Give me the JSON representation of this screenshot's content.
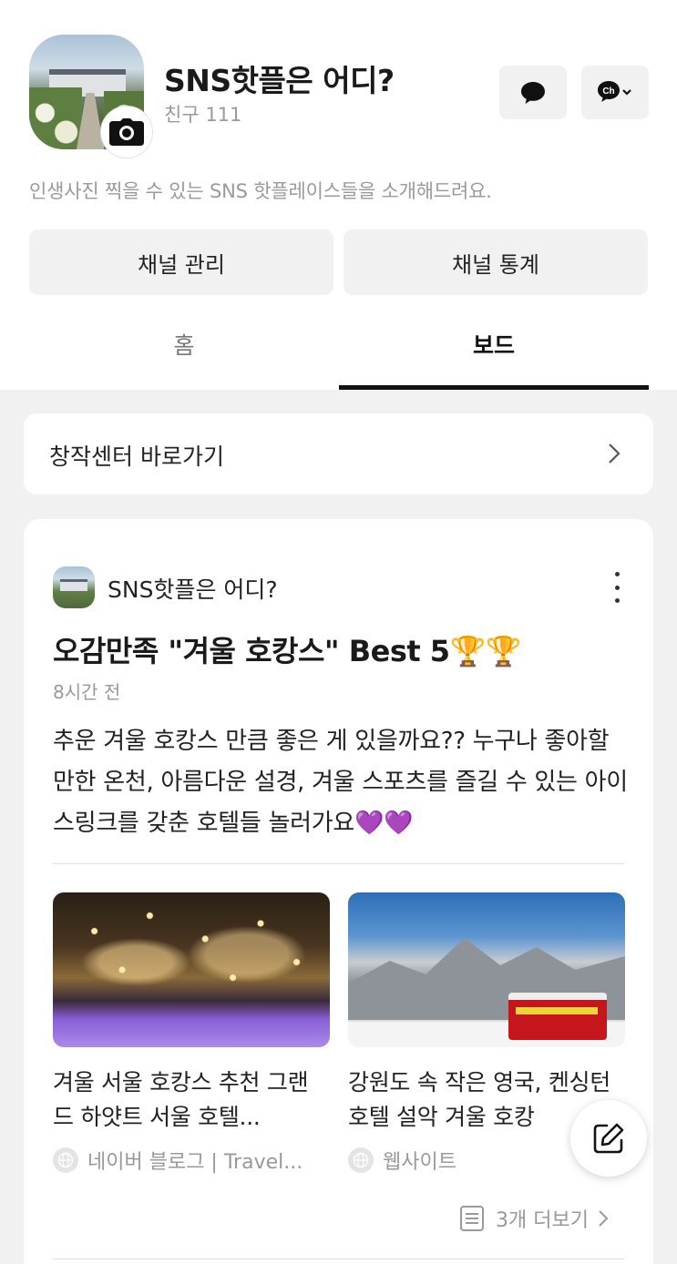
{
  "profile": {
    "name": "SNS핫플은 어디?",
    "friends": "친구 111",
    "description": "인생사진 찍을 수 있는 SNS 핫플레이스들을 소개해드려요."
  },
  "actions": {
    "manage_label": "채널 관리",
    "stats_label": "채널 통계",
    "ch_label": "Ch"
  },
  "tabs": [
    {
      "label": "홈",
      "active": false
    },
    {
      "label": "보드",
      "active": true
    }
  ],
  "creator_center": {
    "label": "창작센터 바로가기"
  },
  "post": {
    "author": "SNS핫플은 어디?",
    "title": "오감만족 \"겨울 호캉스\" Best 5🏆🏆",
    "time": "8시간 전",
    "body": "추운 겨울 호캉스 만큼 좋은 게 있을까요?? 누구나 좋아할 만한 온천, 아름다운 설경, 겨울 스포츠를 즐길 수 있는 아이스링크를 갖춘 호텔들 놀러가요💜💜",
    "links": [
      {
        "title": "겨울 서울 호캉스 추천 그랜드 하얏트 서울 호텔...",
        "source": "네이버 블로그 | Travel..."
      },
      {
        "title": "강원도 속 작은 영국, 켄싱턴호텔 설악 겨울 호캉",
        "source": "웹사이트"
      }
    ],
    "more_label": "3개 더보기"
  },
  "colors": {
    "background": "#f1f1f1",
    "card": "#ffffff",
    "button": "#f1f1f1",
    "text_primary": "#1a1a1a",
    "text_secondary": "#9a9a9a"
  },
  "icons": [
    "camera-icon",
    "chat-bubble-icon",
    "channel-icon",
    "chevron-right-icon",
    "more-vertical-icon",
    "globe-icon",
    "document-icon",
    "edit-icon"
  ]
}
